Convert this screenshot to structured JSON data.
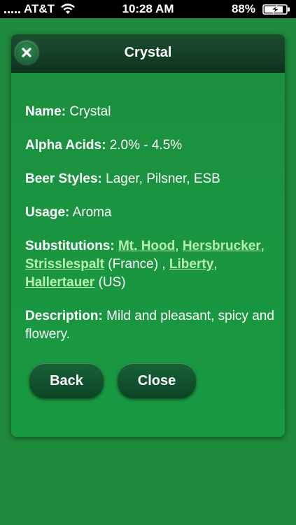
{
  "status_bar": {
    "carrier": "AT&T",
    "time": "10:28 AM",
    "battery_percent": "88%",
    "icons": [
      "signal-icon",
      "wifi-icon",
      "battery-charging-icon"
    ]
  },
  "dialog": {
    "title": "Crystal",
    "close_icon": "close-x-icon",
    "fields": {
      "name": {
        "label": "Name:",
        "value": "Crystal"
      },
      "alpha": {
        "label": "Alpha Acids:",
        "value": "2.0% - 4.5%"
      },
      "styles": {
        "label": "Beer Styles:",
        "value": "Lager, Pilsner, ESB"
      },
      "usage": {
        "label": "Usage:",
        "value": "Aroma"
      },
      "substitutions": {
        "label": "Substitutions:",
        "links": [
          "Mt. Hood",
          "Hersbrucker",
          "Strisslespalt",
          "Liberty",
          "Hallertauer"
        ],
        "france_note": "(France)",
        "us_note": "(US)"
      },
      "description": {
        "label": "Description:",
        "value": "Mild and pleasant, spicy and flowery."
      }
    },
    "buttons": {
      "back": "Back",
      "close": "Close"
    }
  },
  "colors": {
    "background": "#1e8a3b",
    "header": "#0e3320",
    "link": "#b6f0a9",
    "button": "#0c4426"
  }
}
